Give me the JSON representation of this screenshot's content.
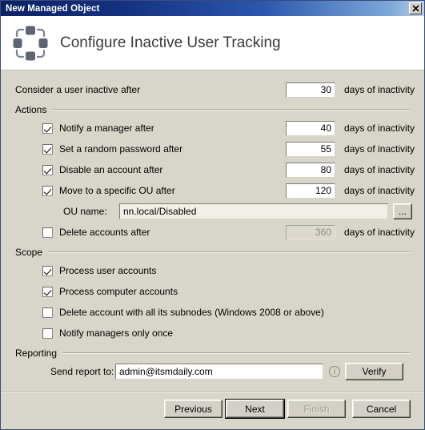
{
  "window": {
    "title": "New Managed Object",
    "close_label": "✕",
    "close_icon": "close-icon"
  },
  "header": {
    "icon": "managed-object-icon",
    "title": "Configure Inactive User Tracking"
  },
  "form": {
    "inactive_row": {
      "label": "Consider a user inactive after",
      "value": "30",
      "units": "days of inactivity"
    },
    "actions_group": {
      "label": "Actions",
      "items": [
        {
          "label": "Notify a manager after",
          "checked": true,
          "value": "40",
          "units": "days of inactivity",
          "enabled": true
        },
        {
          "label": "Set a random password after",
          "checked": true,
          "value": "55",
          "units": "days of inactivity",
          "enabled": true
        },
        {
          "label": "Disable an account after",
          "checked": true,
          "value": "80",
          "units": "days of inactivity",
          "enabled": true
        },
        {
          "label": "Move to a specific OU after",
          "checked": true,
          "value": "120",
          "units": "days of inactivity",
          "enabled": true
        }
      ],
      "ou_name": {
        "label": "OU name:",
        "value": "nn.local/Disabled",
        "browse_label": "..."
      },
      "delete_row": {
        "label": "Delete accounts after",
        "checked": false,
        "value": "360",
        "units": "days of inactivity",
        "enabled": false
      }
    },
    "scope_group": {
      "label": "Scope",
      "items": [
        {
          "label": "Process user accounts",
          "checked": true
        },
        {
          "label": "Process computer accounts",
          "checked": true
        },
        {
          "label": "Delete account with all its subnodes (Windows 2008 or above)",
          "checked": false
        },
        {
          "label": "Notify managers only once",
          "checked": false
        }
      ]
    },
    "reporting_group": {
      "label": "Reporting",
      "send_report_label": "Send report to:",
      "send_report_value": "admin@itsmdaily.com",
      "info_icon": "info-icon",
      "info_glyph": "i",
      "verify_label": "Verify"
    }
  },
  "footer": {
    "previous_label": "Previous",
    "next_label": "Next",
    "finish_label": "Finish",
    "cancel_label": "Cancel"
  },
  "colors": {
    "title_bar_start": "#0c2264",
    "title_bar_end": "#b9cfe6",
    "dialog_bg": "#d8d5ca",
    "header_bg": "#ffffff",
    "icon_gray": "#5f6472"
  }
}
